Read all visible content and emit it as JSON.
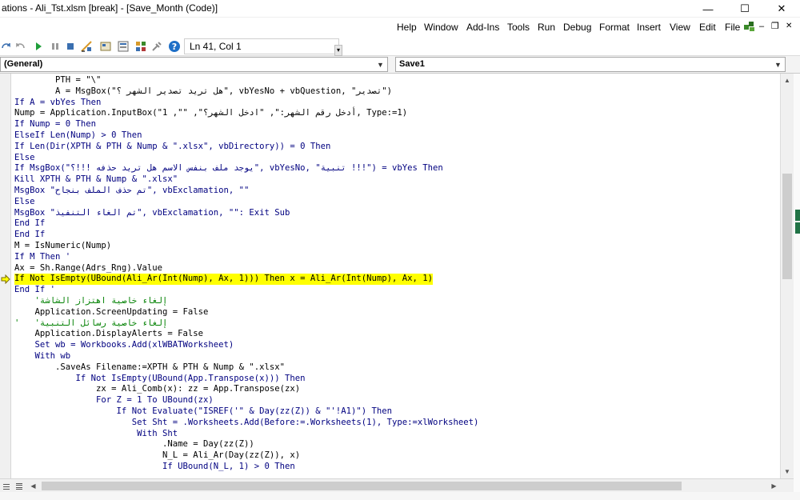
{
  "window": {
    "title": "ations - Ali_Tst.xlsm [break] - [Save_Month (Code)]",
    "minimize_glyph": "—",
    "maximize_glyph": "☐",
    "close_glyph": "✕"
  },
  "menu": {
    "items": [
      "Help",
      "Window",
      "Add-Ins",
      "Tools",
      "Run",
      "Debug",
      "Format",
      "Insert",
      "View",
      "Edit",
      "File"
    ],
    "mdi_minimize": "–",
    "mdi_restore": "❐",
    "mdi_close": "✕"
  },
  "toolbar": {
    "status": "Ln 41, Col 1"
  },
  "dropdowns": {
    "object": "(General)",
    "procedure": "Save1"
  },
  "code": {
    "lines": [
      "        PTH = \"\\\"",
      "        A = MsgBox(\"هل تريد تصدير الشهر ؟\", vbYesNo + vbQuestion, \"تصدير\")",
      "If A = vbYes Then",
      "Nump = Application.InputBox(\"أدخل رقم الشهر:\", \"ادخل الشهر؟\", \"\", 1, Type:=1)",
      "If Nump = 0 Then",
      "ElseIf Len(Nump) > 0 Then",
      "If Len(Dir(XPTH & PTH & Nump & \".xlsx\", vbDirectory)) = 0 Then",
      "Else",
      "If MsgBox(\"يوجد ملف بنفس الاسم هل تريد حذفه !!!؟\", vbYesNo, \"تنبية !!!\") = vbYes Then",
      "Kill XPTH & PTH & Nump & \".xlsx\"",
      "MsgBox \"تم حذف الملف بنجاح\", vbExclamation, \"\"",
      "Else",
      "MsgBox \"تم الغاء التنفيذ\", vbExclamation, \"\": Exit Sub",
      "End If",
      "End If",
      "M = IsNumeric(Nump)",
      "If M Then '",
      "Ax = Sh.Range(Adrs_Rng).Value",
      "If Not IsEmpty(UBound(Ali_Ar(Int(Nump), Ax, 1))) Then x = Ali_Ar(Int(Nump), Ax, 1)",
      "End If '",
      "    'إلغاء خاصية اهتزاز الشاشة",
      "    Application.ScreenUpdating = False",
      "'   'إلغاء خاصية رسائل التنبية",
      "    Application.DisplayAlerts = False",
      "    Set wb = Workbooks.Add(xlWBATWorksheet)",
      "    With wb",
      "        .SaveAs Filename:=XPTH & PTH & Nump & \".xlsx\"",
      "            If Not IsEmpty(UBound(App.Transpose(x))) Then",
      "                zx = Ali_Comb(x): zz = App.Transpose(zx)",
      "                For Z = 1 To UBound(zx)",
      "                    If Not Evaluate(\"ISREF('\" & Day(zz(Z)) & \"'!A1)\") Then",
      "                       Set Sht = .Worksheets.Add(Before:=.Worksheets(1), Type:=xlWorksheet)",
      "                        With Sht",
      "                             .Name = Day(zz(Z))",
      "                             N_L = Ali_Ar(Day(zz(Z)), x)",
      "                             If UBound(N_L, 1) > 0 Then"
    ],
    "highlighted_line": 18,
    "comment_lines": [
      20,
      22
    ]
  },
  "colors": {
    "highlight": "#ffff00",
    "keyword": "#000080",
    "comment": "#008000"
  }
}
